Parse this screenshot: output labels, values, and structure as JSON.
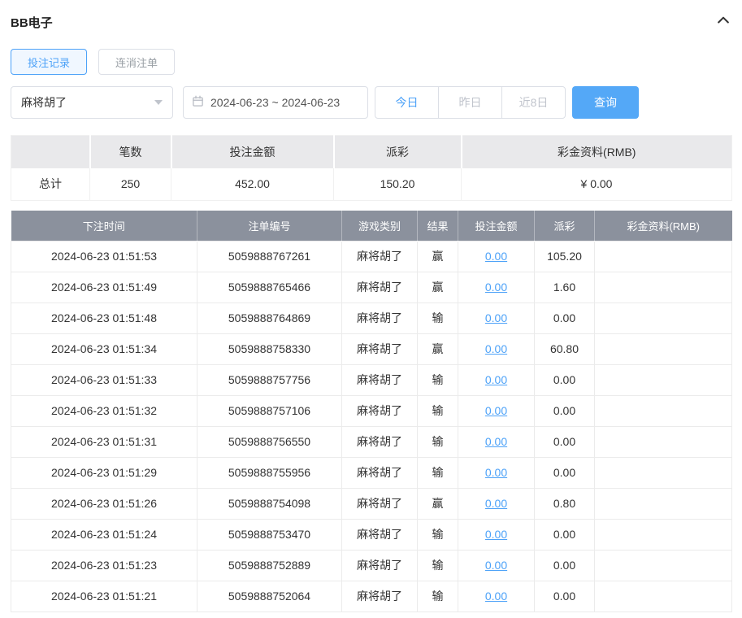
{
  "panel": {
    "title": "BB电子"
  },
  "tabs": [
    {
      "label": "投注记录"
    },
    {
      "label": "连消注单"
    }
  ],
  "filters": {
    "game_select": {
      "value": "麻将胡了"
    },
    "date_range": {
      "value": "2024-06-23 ~ 2024-06-23"
    },
    "quick_ranges": [
      {
        "label": "今日"
      },
      {
        "label": "昨日"
      },
      {
        "label": "近8日"
      }
    ],
    "search_button": "查询"
  },
  "summary": {
    "headers": [
      "",
      "笔数",
      "投注金额",
      "派彩",
      "彩金资料(RMB)"
    ],
    "total": {
      "label": "总计",
      "count": "250",
      "bet_amount": "452.00",
      "payout": "150.20",
      "jackpot": "¥ 0.00"
    }
  },
  "table": {
    "headers": [
      "下注时间",
      "注单编号",
      "游戏类别",
      "结果",
      "投注金额",
      "派彩",
      "彩金资料(RMB)"
    ],
    "keys": [
      "bet_time",
      "order_no",
      "game_type",
      "result",
      "bet_amount",
      "payout",
      "jackpot"
    ],
    "rows": [
      [
        "2024-06-23 01:51:53",
        "5059888767261",
        "麻将胡了",
        "赢",
        "0.00",
        "105.20",
        ""
      ],
      [
        "2024-06-23 01:51:49",
        "5059888765466",
        "麻将胡了",
        "赢",
        "0.00",
        "1.60",
        ""
      ],
      [
        "2024-06-23 01:51:48",
        "5059888764869",
        "麻将胡了",
        "输",
        "0.00",
        "0.00",
        ""
      ],
      [
        "2024-06-23 01:51:34",
        "5059888758330",
        "麻将胡了",
        "赢",
        "0.00",
        "60.80",
        ""
      ],
      [
        "2024-06-23 01:51:33",
        "5059888757756",
        "麻将胡了",
        "输",
        "0.00",
        "0.00",
        ""
      ],
      [
        "2024-06-23 01:51:32",
        "5059888757106",
        "麻将胡了",
        "输",
        "0.00",
        "0.00",
        ""
      ],
      [
        "2024-06-23 01:51:31",
        "5059888756550",
        "麻将胡了",
        "输",
        "0.00",
        "0.00",
        ""
      ],
      [
        "2024-06-23 01:51:29",
        "5059888755956",
        "麻将胡了",
        "输",
        "0.00",
        "0.00",
        ""
      ],
      [
        "2024-06-23 01:51:26",
        "5059888754098",
        "麻将胡了",
        "赢",
        "0.00",
        "0.80",
        ""
      ],
      [
        "2024-06-23 01:51:24",
        "5059888753470",
        "麻将胡了",
        "输",
        "0.00",
        "0.00",
        ""
      ],
      [
        "2024-06-23 01:51:23",
        "5059888752889",
        "麻将胡了",
        "输",
        "0.00",
        "0.00",
        ""
      ],
      [
        "2024-06-23 01:51:21",
        "5059888752064",
        "麻将胡了",
        "输",
        "0.00",
        "0.00",
        ""
      ]
    ]
  },
  "colors": {
    "accent": "#4da2f8",
    "search_button_bg": "#54a8f7",
    "table_header_bg": "#8b919d",
    "summary_header_bg": "#e9e9eb"
  }
}
